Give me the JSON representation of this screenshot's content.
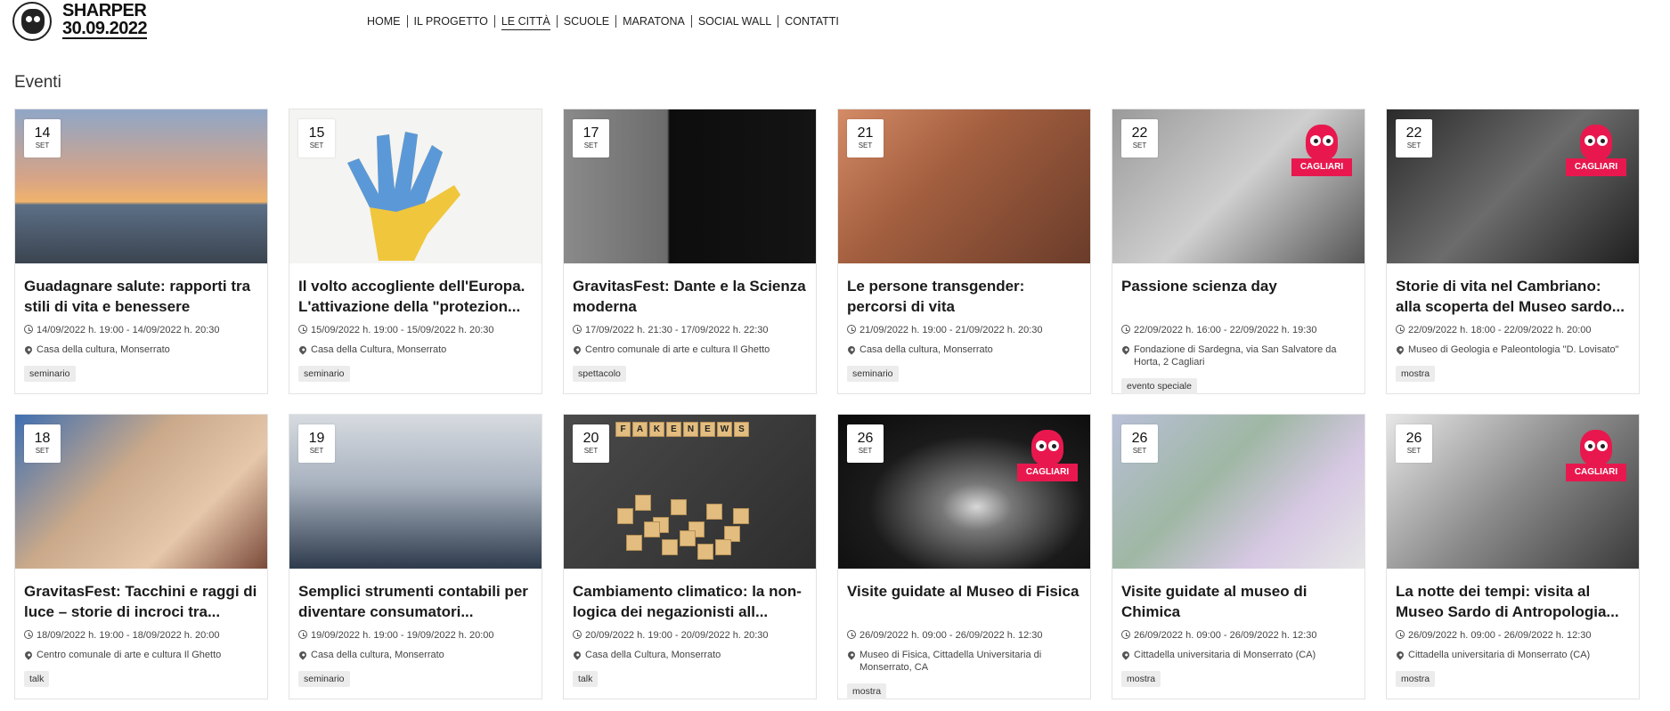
{
  "logo": {
    "line1": "SHARPER",
    "line2": "30.09.2022"
  },
  "nav": [
    {
      "label": "HOME",
      "active": false
    },
    {
      "label": "IL PROGETTO",
      "active": false
    },
    {
      "label": "LE CITTÀ",
      "active": true
    },
    {
      "label": "SCUOLE",
      "active": false
    },
    {
      "label": "MARATONA",
      "active": false
    },
    {
      "label": "SOCIAL WALL",
      "active": false
    },
    {
      "label": "CONTATTI",
      "active": false
    }
  ],
  "section_title": "Eventi",
  "brand_label": "CAGLIARI",
  "events": [
    {
      "day": "14",
      "month": "SET",
      "title": "Guadagnare salute: rapporti tra stili di vita e benessere",
      "time": "14/09/2022 h. 19:00 - 14/09/2022 h. 20:30",
      "place": "Casa della cultura, Monserrato",
      "tag": "seminario",
      "brand": false
    },
    {
      "day": "15",
      "month": "SET",
      "title": "Il volto accogliente dell'Europa. L'attivazione della \"protezion...",
      "time": "15/09/2022 h. 19:00 - 15/09/2022 h. 20:30",
      "place": "Casa della Cultura, Monserrato",
      "tag": "seminario",
      "brand": false
    },
    {
      "day": "17",
      "month": "SET",
      "title": "GravitasFest: Dante e la Scienza moderna",
      "time": "17/09/2022 h. 21:30 - 17/09/2022 h. 22:30",
      "place": "Centro comunale di arte e cultura Il Ghetto",
      "tag": "spettacolo",
      "brand": false
    },
    {
      "day": "21",
      "month": "SET",
      "title": "Le persone transgender: percorsi di vita",
      "time": "21/09/2022 h. 19:00 - 21/09/2022 h. 20:30",
      "place": "Casa della cultura, Monserrato",
      "tag": "seminario",
      "brand": false
    },
    {
      "day": "22",
      "month": "SET",
      "title": "Passione scienza day",
      "time": "22/09/2022 h. 16:00 - 22/09/2022 h. 19:30",
      "place": "Fondazione di Sardegna, via San Salvatore da Horta, 2 Cagliari",
      "tag": "evento speciale",
      "brand": true
    },
    {
      "day": "22",
      "month": "SET",
      "title": "Storie di vita nel Cambriano: alla scoperta del Museo sardo...",
      "time": "22/09/2022 h. 18:00 - 22/09/2022 h. 20:00",
      "place": "Museo di Geologia e Paleontologia \"D. Lovisato\"",
      "tag": "mostra",
      "brand": true
    },
    {
      "day": "18",
      "month": "SET",
      "title": "GravitasFest: Tacchini e raggi di luce – storie di incroci tra...",
      "time": "18/09/2022 h. 19:00 - 18/09/2022 h. 20:00",
      "place": "Centro comunale di arte e cultura Il Ghetto",
      "tag": "talk",
      "brand": false
    },
    {
      "day": "19",
      "month": "SET",
      "title": "Semplici strumenti contabili per diventare consumatori...",
      "time": "19/09/2022 h. 19:00 - 19/09/2022 h. 20:00",
      "place": "Casa della cultura, Monserrato",
      "tag": "seminario",
      "brand": false
    },
    {
      "day": "20",
      "month": "SET",
      "title": "Cambiamento climatico: la non-logica dei negazionisti all...",
      "time": "20/09/2022 h. 19:00 - 20/09/2022 h. 20:30",
      "place": "Casa della Cultura, Monserrato",
      "tag": "talk",
      "brand": false
    },
    {
      "day": "26",
      "month": "SET",
      "title": "Visite guidate al Museo di Fisica",
      "time": "26/09/2022 h. 09:00 - 26/09/2022 h. 12:30",
      "place": "Museo di Fisica, Cittadella Universitaria di Monserrato, CA",
      "tag": "mostra",
      "brand": true
    },
    {
      "day": "26",
      "month": "SET",
      "title": "Visite guidate al museo di Chimica",
      "time": "26/09/2022 h. 09:00 - 26/09/2022 h. 12:30",
      "place": "Cittadella universitaria di Monserrato (CA)",
      "tag": "mostra",
      "brand": false
    },
    {
      "day": "26",
      "month": "SET",
      "title": "La notte dei tempi: visita al Museo Sardo di Antropologia...",
      "time": "26/09/2022 h. 09:00 - 26/09/2022 h. 12:30",
      "place": "Cittadella universitaria di Monserrato (CA)",
      "tag": "mostra",
      "brand": true
    }
  ],
  "fake_news_letters": [
    "F",
    "A",
    "K",
    "E",
    "N",
    "E",
    "W",
    "S"
  ]
}
